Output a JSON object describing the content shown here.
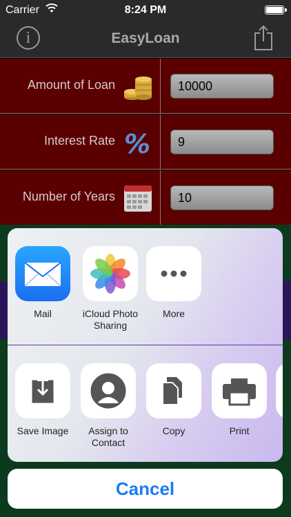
{
  "status_bar": {
    "carrier": "Carrier",
    "time": "8:24 PM"
  },
  "nav": {
    "title": "EasyLoan",
    "info_icon": "info-icon",
    "share_icon": "share-icon"
  },
  "form": {
    "rows": [
      {
        "label": "Amount of Loan",
        "value": "10000",
        "icon": "coins-icon"
      },
      {
        "label": "Interest Rate",
        "value": "9",
        "icon": "percent-icon"
      },
      {
        "label": "Number of Years",
        "value": "10",
        "icon": "calendar-icon"
      }
    ]
  },
  "share_sheet": {
    "apps": [
      {
        "label": "Mail",
        "icon": "mail-icon"
      },
      {
        "label": "iCloud Photo Sharing",
        "icon": "photos-icon"
      },
      {
        "label": "More",
        "icon": "more-icon"
      }
    ],
    "actions": [
      {
        "label": "Save Image",
        "icon": "save-image-icon"
      },
      {
        "label": "Assign to Contact",
        "icon": "contact-icon"
      },
      {
        "label": "Copy",
        "icon": "copy-icon"
      },
      {
        "label": "Print",
        "icon": "print-icon"
      }
    ],
    "cancel_label": "Cancel"
  },
  "colors": {
    "row_background": "#5a0000",
    "nav_background": "#2a2a2a",
    "accent_blue": "#1a7cf5"
  }
}
